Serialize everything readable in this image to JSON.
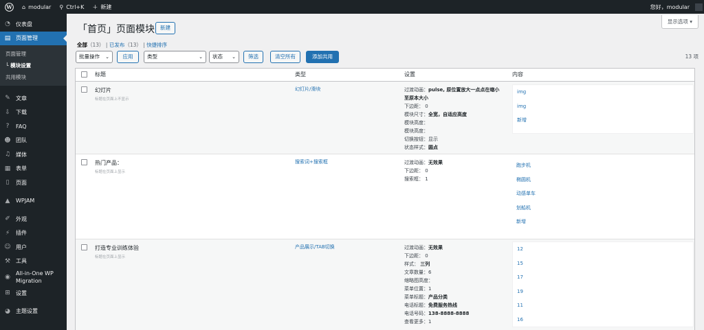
{
  "adminbar": {
    "site": "modular",
    "search": "Ctrl+K",
    "new": "新建",
    "greeting": "您好，modular"
  },
  "sidebar": {
    "dashboard": "仪表盘",
    "page_manage": "页面管理",
    "sub": [
      "页面管理",
      "└ 模块设置",
      "共用模块"
    ],
    "items": [
      "文章",
      "下载",
      "FAQ",
      "团队",
      "媒体",
      "表单",
      "页面",
      "WPJAM",
      "外观",
      "插件",
      "用户",
      "工具",
      "All-in-One WP",
      "Migration",
      "设置",
      "主题设置"
    ]
  },
  "screen_options": "显示选项 ▾",
  "page_title": "「首页」页面模块",
  "new_button": "新建",
  "views": {
    "all": "全部",
    "all_count": "（13）",
    "published": "已发布",
    "published_count": "（13）",
    "sort": "快捷排序"
  },
  "filters": {
    "bulk": "批量操作",
    "apply": "应用",
    "type": "类型",
    "status": "状态",
    "filter": "筛选",
    "clear": "清空所有",
    "add_shared": "添加共用",
    "count": "13 项"
  },
  "columns": {
    "title": "标题",
    "type": "类型",
    "settings": "设置",
    "content": "内容"
  },
  "rows": [
    {
      "title": "幻灯片",
      "note": "标题在页面上不显示",
      "type": "幻灯片/滑块",
      "settings": [
        "过渡动画：<b>pulse, 原位置放大一点点在缩小至原本大小</b>",
        "下边距：  0",
        "模块尺寸：<b>全宽，自适应高度</b>",
        "模块高度：",
        "模块高度：",
        "切换按钮：显示",
        "状态样式：<b>圆点</b>"
      ],
      "content": [
        "img",
        "img",
        "新增"
      ]
    },
    {
      "title": "热门产品：",
      "note": "标题在页面上显示",
      "type": "搜索词+搜索框",
      "settings": [
        "过渡动画：<b>无效果</b>",
        "下边距：  0",
        "搜索框：  1"
      ],
      "content": [
        "跑步机",
        "椭圆机",
        "动感单车",
        "划船机",
        "新增"
      ]
    },
    {
      "title": "打造专业训练体验",
      "note": "标题在页面上显示",
      "type": "产品展示/TAB切换",
      "settings": [
        "过渡动画：<b>无效果</b>",
        "下边距：  0",
        "样式：    <b>三列</b>",
        "文章数量：6",
        "缩略图高度：",
        "菜单位置：1",
        "菜单标题：<b>产品分类</b>",
        "电话标题：<b>免费服务热线</b>",
        "电话号码：<b>138-8888-8888</b>",
        "查看更多：1"
      ],
      "content": [
        "12",
        "15",
        "17",
        "19",
        "11",
        "16"
      ]
    }
  ]
}
